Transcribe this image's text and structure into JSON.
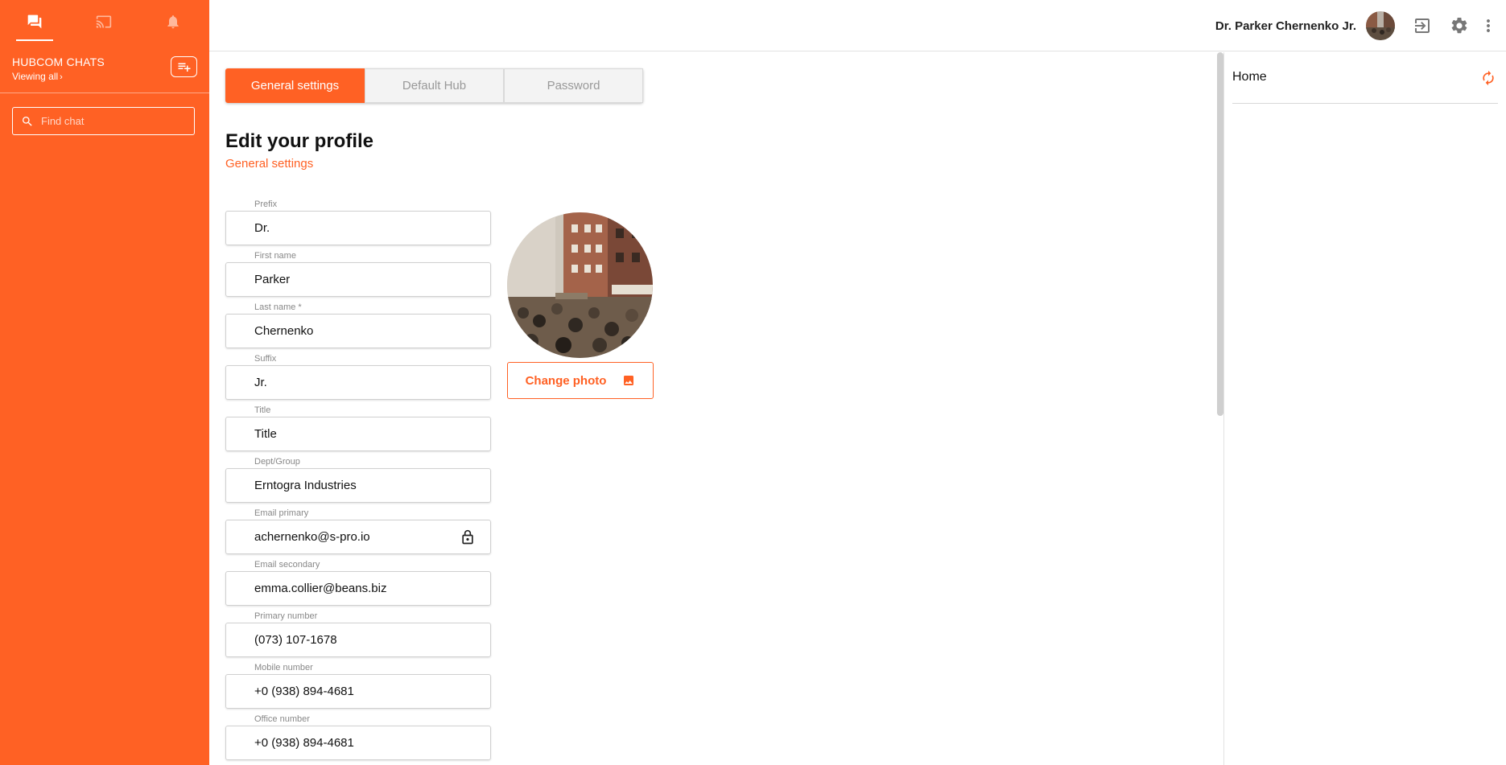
{
  "sidebar": {
    "tabs": [
      {
        "icon": "chat-icon",
        "active": true
      },
      {
        "icon": "cast-icon",
        "active": false
      },
      {
        "icon": "bell-icon",
        "active": false
      }
    ],
    "title": "HUBCOM CHATS",
    "viewing": "Viewing all",
    "search_placeholder": "Find chat",
    "accent": "#ff6124"
  },
  "topbar": {
    "user_name": "Dr. Parker Chernenko Jr."
  },
  "main": {
    "tabs": [
      {
        "label": "General settings",
        "active": true
      },
      {
        "label": "Default Hub",
        "active": false
      },
      {
        "label": "Password",
        "active": false
      }
    ],
    "title": "Edit your profile",
    "subtitle": "General settings",
    "fields": [
      {
        "label": "Prefix",
        "value": "Dr."
      },
      {
        "label": "First name",
        "value": "Parker"
      },
      {
        "label": "Last name *",
        "value": "Chernenko"
      },
      {
        "label": "Suffix",
        "value": "Jr."
      },
      {
        "label": "Title",
        "value": "Title"
      },
      {
        "label": "Dept/Group",
        "value": "Erntogra Industries"
      },
      {
        "label": "Email primary",
        "value": "achernenko@s-pro.io",
        "locked": true
      },
      {
        "label": "Email secondary",
        "value": "emma.collier@beans.biz"
      },
      {
        "label": "Primary number",
        "value": "(073) 107-1678"
      },
      {
        "label": "Mobile number",
        "value": "+0 (938) 894-4681"
      },
      {
        "label": "Office number",
        "value": "+0 (938) 894-4681"
      }
    ],
    "change_photo": "Change photo"
  },
  "right_panel": {
    "title": "Home"
  }
}
